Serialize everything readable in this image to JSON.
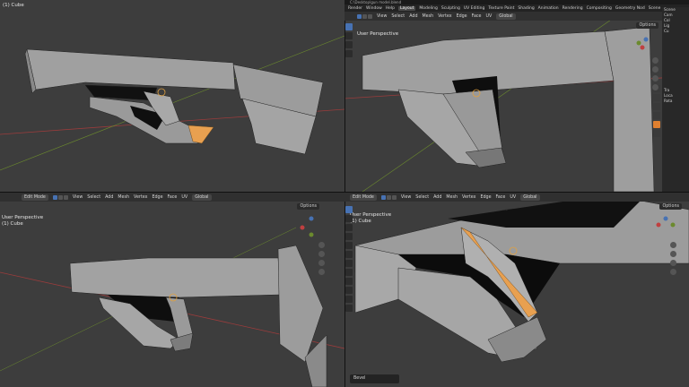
{
  "colors": {
    "viewport_bg": "#3d3d3d",
    "mesh_face": "#a8a8a8",
    "mesh_dark": "#0d0d0d",
    "selected_edge": "#e8a050",
    "axis_x": "#9a3c3c",
    "axis_y": "#6b8a2e",
    "accent_blue": "#4772b3"
  },
  "q1": {
    "object_label": "(1) Cube"
  },
  "q2": {
    "title": "C:\\Desktop\\gun model.blend",
    "menu": [
      "File",
      "Edit",
      "Render",
      "Window",
      "Help"
    ],
    "workspaces": [
      "Layout",
      "Modeling",
      "Sculpting",
      "UV Editing",
      "Texture Paint",
      "Shading",
      "Animation",
      "Rendering",
      "Compositing",
      "Geometry Nod"
    ],
    "active_workspace": "Layout",
    "header": {
      "mode": "Edit Mode",
      "menus": [
        "View",
        "Select",
        "Add",
        "Mesh",
        "Vertex",
        "Edge",
        "Face",
        "UV"
      ],
      "transform": "Global",
      "options": "Options",
      "scene": "Scene"
    },
    "perspective": "User Perspective",
    "object_label": "(1) Cube",
    "outliner_items": [
      "Scene",
      "Cam",
      "Col",
      "Lig",
      "Cu"
    ],
    "props_items": [
      "Tra",
      "Loca",
      "Rota"
    ]
  },
  "q3": {
    "header": {
      "mode": "Edit Mode",
      "menus": [
        "View",
        "Select",
        "Add",
        "Mesh",
        "Vertex",
        "Edge",
        "Face",
        "UV"
      ],
      "transform": "Global",
      "options": "Options"
    },
    "perspective": "User Perspective",
    "object_label": "(1) Cube"
  },
  "q4": {
    "header": {
      "mode": "Edit Mode",
      "menus": [
        "View",
        "Select",
        "Add",
        "Mesh",
        "Vertex",
        "Edge",
        "Face",
        "UV"
      ],
      "transform": "Global",
      "options": "Options"
    },
    "perspective": "User Perspective",
    "object_label": "(1) Cube",
    "operator_panel": "Bevel"
  }
}
